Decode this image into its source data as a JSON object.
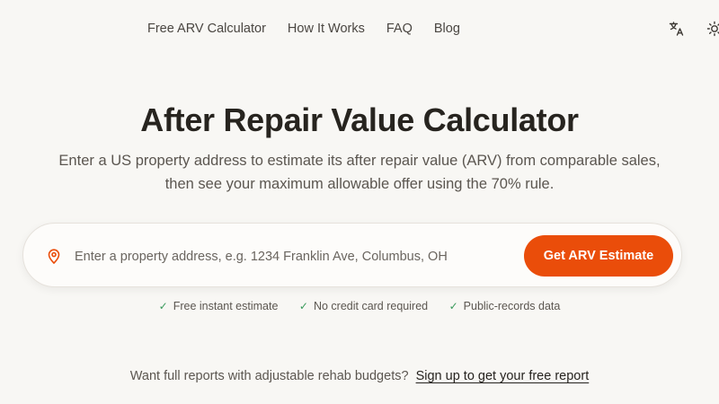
{
  "nav": {
    "links": [
      {
        "label": "Free ARV Calculator"
      },
      {
        "label": "How It Works"
      },
      {
        "label": "FAQ"
      },
      {
        "label": "Blog"
      }
    ],
    "icons": [
      "translate-icon",
      "sun-icon"
    ]
  },
  "hero": {
    "title": "After Repair Value Calculator",
    "subtitle": "Enter a US property address to estimate its after repair value (ARV) from comparable sales, then see your maximum allowable offer using the 70% rule."
  },
  "search": {
    "placeholder": "Enter a property address, e.g. 1234 Franklin Ave, Columbus, OH",
    "value": "",
    "button_label": "Get ARV Estimate",
    "icon": "map-pin-icon"
  },
  "features": [
    {
      "label": "Free instant estimate"
    },
    {
      "label": "No credit card required"
    },
    {
      "label": "Public-records data"
    }
  ],
  "promo": {
    "text": "Want full reports with adjustable rehab budgets?",
    "link": "Sign up to get your free report"
  },
  "colors": {
    "accent": "#ea4d0a",
    "background": "#f8f7f4",
    "check": "#3a9a5b"
  }
}
